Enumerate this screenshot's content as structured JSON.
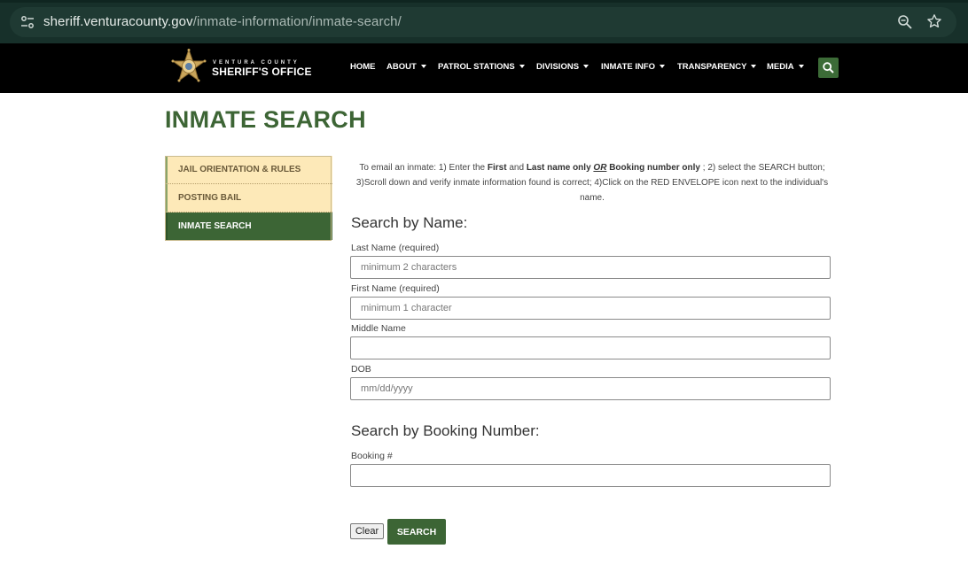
{
  "browser": {
    "url_domain": "sheriff.venturacounty.gov",
    "url_path": "/inmate-information/inmate-search/"
  },
  "header": {
    "logo_small": "VENTURA COUNTY",
    "logo_title": "SHERIFF'S OFFICE",
    "nav": [
      {
        "label": "HOME"
      },
      {
        "label": "ABOUT"
      },
      {
        "label": "PATROL STATIONS"
      },
      {
        "label": "DIVISIONS"
      },
      {
        "label": "INMATE INFO"
      },
      {
        "label": "TRANSPARENCY"
      },
      {
        "label": "MEDIA"
      }
    ]
  },
  "page": {
    "title": "INMATE SEARCH"
  },
  "sidebar": {
    "items": [
      {
        "label": "JAIL ORIENTATION & RULES"
      },
      {
        "label": "POSTING BAIL"
      },
      {
        "label": "INMATE SEARCH"
      }
    ]
  },
  "instructions": {
    "p1": "To email an inmate: 1) Enter the ",
    "first": "First",
    "and": " and ",
    "last_name_only": "Last name only",
    "or": "OR",
    "booking_only": "Booking number only",
    "p2": " ; 2) select the SEARCH button;  3)Scroll down and verify inmate information found is correct; 4)Click on the RED ENVELOPE icon next to the individual's name."
  },
  "search_by_name": {
    "heading": "Search by Name:",
    "last_name_label": "Last Name (required)",
    "last_name_placeholder": "minimum 2 characters",
    "first_name_label": "First Name (required)",
    "first_name_placeholder": "minimum 1 character",
    "middle_name_label": "Middle Name",
    "middle_name_placeholder": "",
    "dob_label": "DOB",
    "dob_placeholder": "mm/dd/yyyy"
  },
  "search_by_booking": {
    "heading": "Search by Booking Number:",
    "booking_label": "Booking #",
    "booking_placeholder": ""
  },
  "buttons": {
    "clear": "Clear",
    "search": "SEARCH"
  },
  "colors": {
    "brand_green": "#3c6535",
    "sidebar_bg": "#fde9b8",
    "header_bg": "#000000",
    "chrome_bg": "#17302a"
  }
}
